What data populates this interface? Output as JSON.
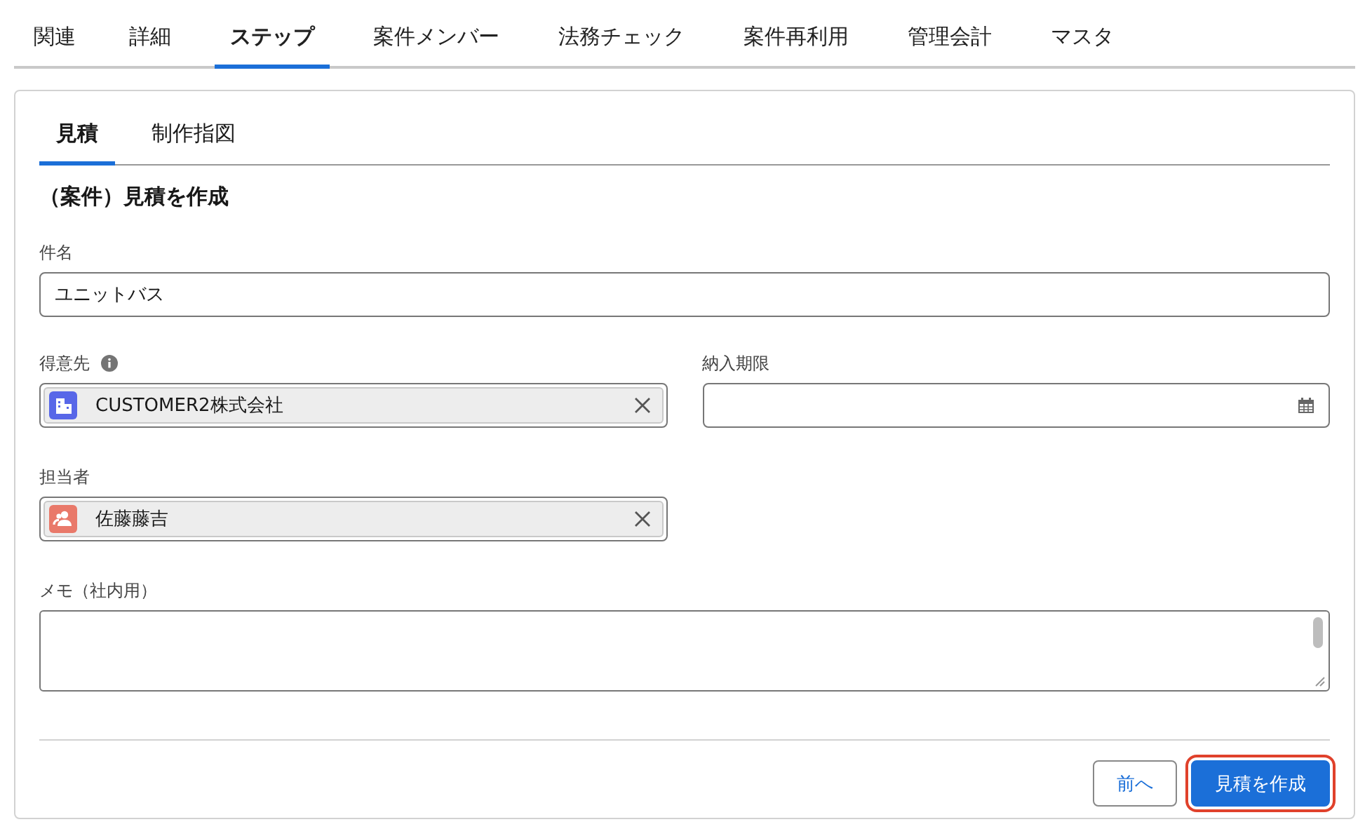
{
  "tabs": [
    {
      "label": "関連",
      "selected": false
    },
    {
      "label": "詳細",
      "selected": false
    },
    {
      "label": "ステップ",
      "selected": true
    },
    {
      "label": "案件メンバー",
      "selected": false
    },
    {
      "label": "法務チェック",
      "selected": false
    },
    {
      "label": "案件再利用",
      "selected": false
    },
    {
      "label": "管理会計",
      "selected": false
    },
    {
      "label": "マスタ",
      "selected": false
    }
  ],
  "subtabs": [
    {
      "label": "見積",
      "selected": true
    },
    {
      "label": "制作指図",
      "selected": false
    }
  ],
  "form_title": "（案件）見積を作成",
  "fields": [
    {
      "kind": "text",
      "label": "件名",
      "value": "ユニットバス"
    },
    {
      "kind": "account",
      "label": "得意先",
      "info": true,
      "value": "CUSTOMER2株式会社"
    },
    {
      "kind": "date",
      "label": "納入期限"
    },
    {
      "kind": "user",
      "label": "担当者",
      "info": false,
      "value": "佐藤藤吉"
    },
    {
      "kind": "textarea",
      "label": "メモ（社内用）"
    }
  ],
  "buttons": [
    {
      "label": "前へ",
      "kind": "neutral",
      "highlighted": false
    },
    {
      "label": "見積を作成",
      "kind": "brand",
      "highlighted": true
    }
  ]
}
